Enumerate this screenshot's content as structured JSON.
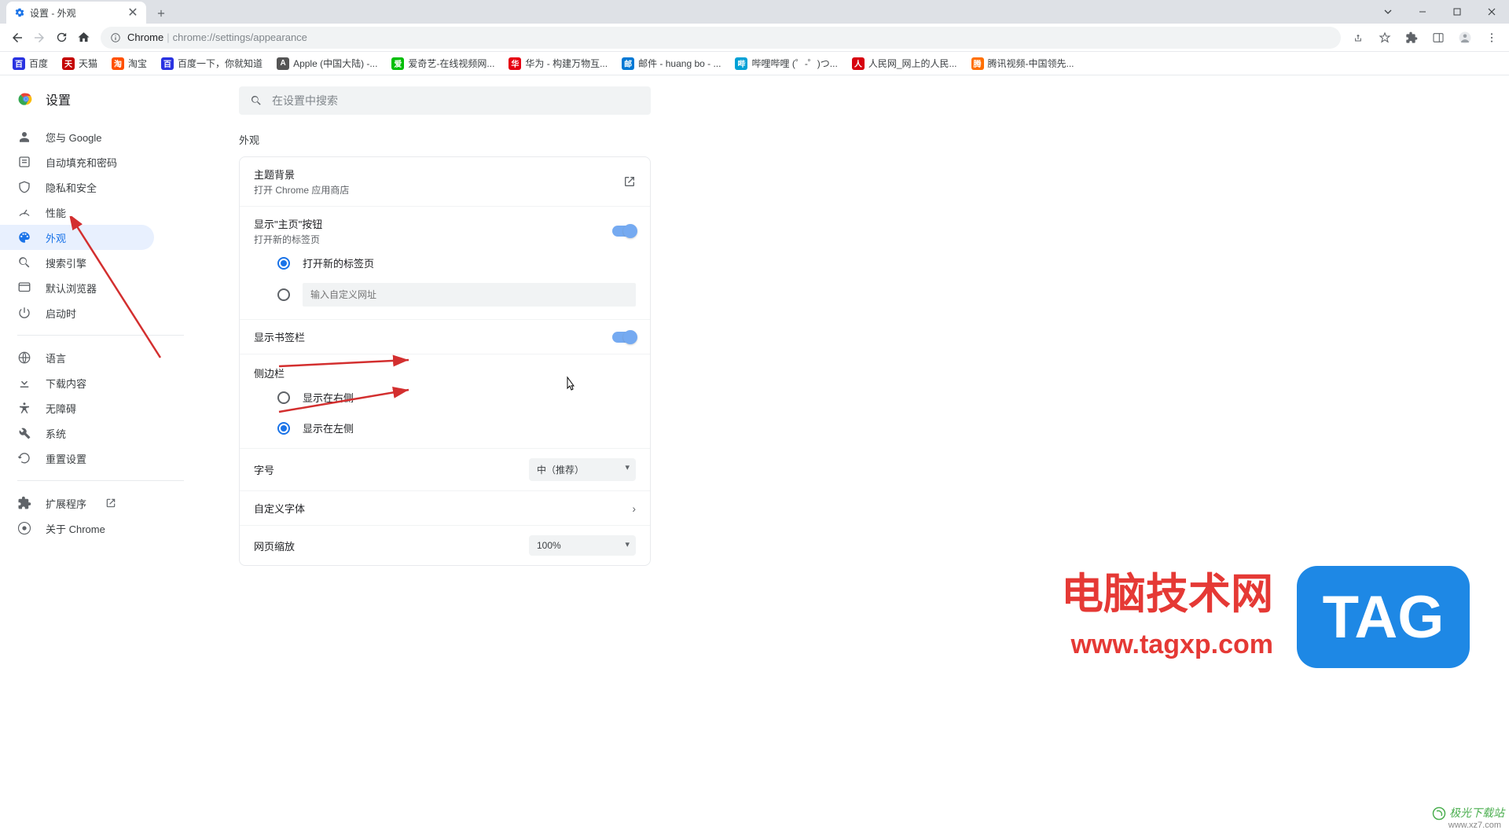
{
  "window": {
    "tab_title": "设置 - 外观"
  },
  "url": {
    "origin": "Chrome",
    "path": "chrome://settings/appearance"
  },
  "bookmarks": [
    {
      "label": "百度",
      "color": "#2932e1"
    },
    {
      "label": "天猫",
      "color": "#c40000"
    },
    {
      "label": "淘宝",
      "color": "#ff5000"
    },
    {
      "label": "百度一下，你就知道",
      "color": "#2932e1"
    },
    {
      "label": "Apple (中国大陆) -...",
      "color": "#555"
    },
    {
      "label": "爱奇艺-在线视频网...",
      "color": "#00be06"
    },
    {
      "label": "华为 - 构建万物互...",
      "color": "#e60012"
    },
    {
      "label": "邮件 - huang bo - ...",
      "color": "#0078d4"
    },
    {
      "label": "哔哩哔哩 (゜-゜)つ...",
      "color": "#00a1d6"
    },
    {
      "label": "人民网_网上的人民...",
      "color": "#d7000f"
    },
    {
      "label": "腾讯视频-中国领先...",
      "color": "#ff6f00"
    }
  ],
  "settings_header": "设置",
  "search_placeholder": "在设置中搜索",
  "sidebar": [
    {
      "icon": "person",
      "label": "您与 Google"
    },
    {
      "icon": "autofill",
      "label": "自动填充和密码"
    },
    {
      "icon": "shield",
      "label": "隐私和安全"
    },
    {
      "icon": "speed",
      "label": "性能"
    },
    {
      "icon": "palette",
      "label": "外观",
      "active": true
    },
    {
      "icon": "search",
      "label": "搜索引擎"
    },
    {
      "icon": "browser",
      "label": "默认浏览器"
    },
    {
      "icon": "power",
      "label": "启动时"
    }
  ],
  "sidebar2": [
    {
      "icon": "globe",
      "label": "语言"
    },
    {
      "icon": "download",
      "label": "下载内容"
    },
    {
      "icon": "a11y",
      "label": "无障碍"
    },
    {
      "icon": "wrench",
      "label": "系统"
    },
    {
      "icon": "reset",
      "label": "重置设置"
    }
  ],
  "sidebar3": [
    {
      "icon": "ext",
      "label": "扩展程序",
      "external": true
    },
    {
      "icon": "chrome",
      "label": "关于 Chrome"
    }
  ],
  "section_title": "外观",
  "theme": {
    "title": "主题背景",
    "sub": "打开 Chrome 应用商店"
  },
  "home_btn": {
    "title": "显示\"主页\"按钮",
    "sub": "打开新的标签页"
  },
  "home_radios": {
    "newtab": "打开新的标签页",
    "custom_placeholder": "输入自定义网址"
  },
  "bookmarks_bar_label": "显示书签栏",
  "sidepanel_label": "侧边栏",
  "sidepanel_radios": {
    "right": "显示在右侧",
    "left": "显示在左侧"
  },
  "font_row": {
    "label": "字号",
    "value": "中（推荐）"
  },
  "custom_font_label": "自定义字体",
  "zoom_row": {
    "label": "网页缩放",
    "value": "100%"
  },
  "watermark": {
    "line1": "电脑技术网",
    "line2": "www.tagxp.com",
    "tag": "TAG",
    "corner": "极光下载站",
    "corner_sub": "www.xz7.com"
  }
}
